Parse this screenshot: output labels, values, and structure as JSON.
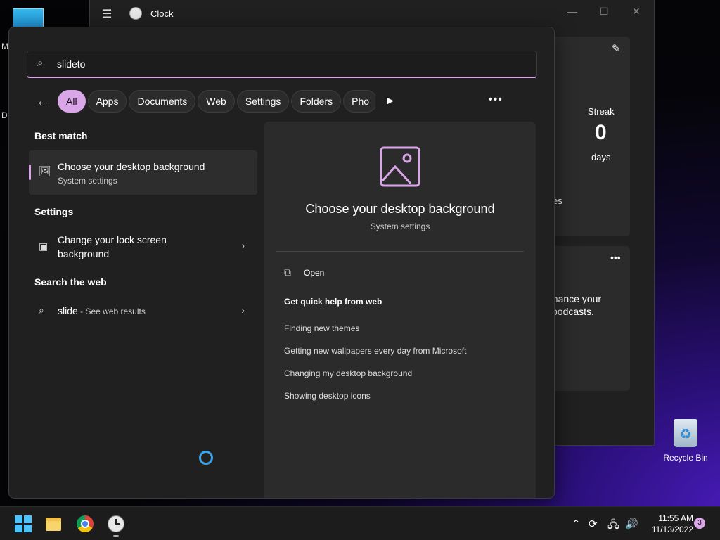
{
  "desktop": {
    "left_texts": [
      "M",
      "Da"
    ],
    "recycle_bin_label": "Recycle Bin"
  },
  "clock_window": {
    "title": "Clock",
    "streak_label": "Streak",
    "streak_value": "0",
    "streak_unit": "days",
    "partial_text_1": "es",
    "partial_text_2": "nhance your",
    "partial_text_3": "l podcasts."
  },
  "search": {
    "query": "slideto",
    "filters": [
      "All",
      "Apps",
      "Documents",
      "Web",
      "Settings",
      "Folders",
      "Pho"
    ],
    "active_filter": "All"
  },
  "results": {
    "best_match_heading": "Best match",
    "best_match": {
      "title": "Choose your desktop background",
      "subtitle": "System settings"
    },
    "settings_heading": "Settings",
    "settings_item": {
      "title_line1": "Change your lock screen",
      "title_line2": "background"
    },
    "web_heading": "Search the web",
    "web_item": {
      "query": "slide",
      "suffix": " - See web results"
    }
  },
  "preview": {
    "title": "Choose your desktop background",
    "subtitle": "System settings",
    "open_label": "Open",
    "help_heading": "Get quick help from web",
    "help_links": [
      "Finding new themes",
      "Getting new wallpapers every day from Microsoft",
      "Changing my desktop background",
      "Showing desktop icons"
    ]
  },
  "taskbar": {
    "time": "11:55 AM",
    "date": "11/13/2022",
    "notification_count": "3"
  },
  "colors": {
    "accent": "#d9a6e8",
    "panel_bg": "#202020",
    "preview_bg": "#2b2b2b",
    "spinner": "#3ba3e8"
  }
}
